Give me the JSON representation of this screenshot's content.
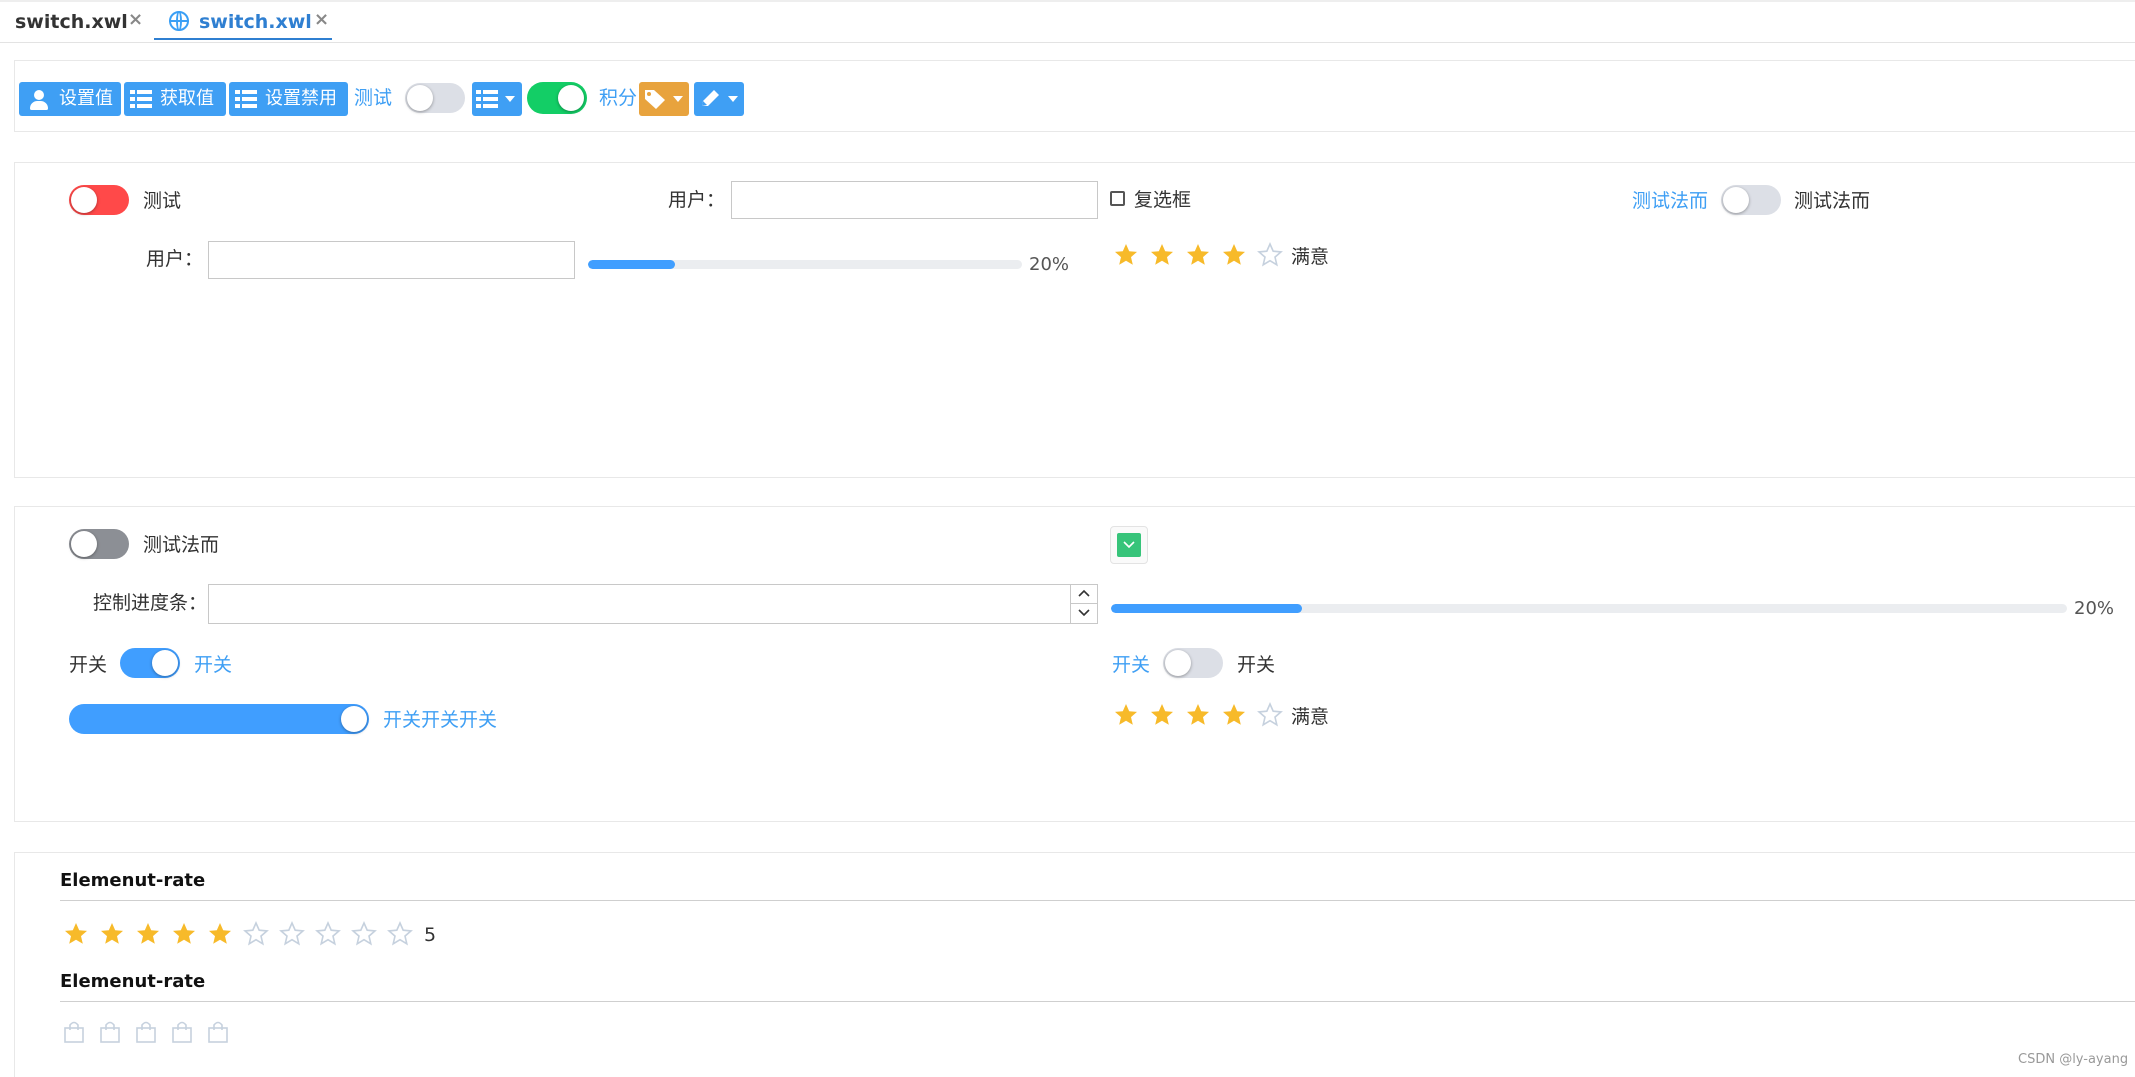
{
  "tabs": [
    {
      "label": "switch.xwl",
      "active": false
    },
    {
      "label": "switch.xwl",
      "active": true
    }
  ],
  "toolbar": {
    "set_value": "设置值",
    "get_value": "获取值",
    "set_disabled": "设置禁用",
    "test_label": "测试",
    "points_label": "积分"
  },
  "panel1": {
    "switch_label": "测试",
    "user_label_1": "用户：",
    "user_value_1": "",
    "checkbox_label": "复选框",
    "right_link": "测试法而",
    "right_switch_label": "测试法而",
    "user_label_2": "用户：",
    "user_value_2": "",
    "progress": 20,
    "progress_text": "20%",
    "rating": 4,
    "rating_max": 5,
    "rating_text": "满意"
  },
  "panel2": {
    "switch_label": "测试法而",
    "progress_label": "控制进度条：",
    "progress_input_value": "",
    "progress": 20,
    "progress_text": "20%",
    "switch2_left": "开关",
    "switch2_right": "开关",
    "switch3_left": "开关",
    "switch3_right": "开关",
    "wide_switch_text": "开关开关开关",
    "rating": 4,
    "rating_max": 5,
    "rating_text": "满意"
  },
  "panel3": {
    "title1": "Elemenut-rate",
    "rating": 5,
    "rating_max": 10,
    "rating_text": "5",
    "title2": "Elemenut-rate",
    "bag_count": 5
  },
  "footer": {
    "watermark": "CSDN @ly-ayang"
  },
  "colors": {
    "primary": "#409eff",
    "orange": "#e8a33d",
    "red": "#ff4949",
    "green": "#13ce66",
    "gray_switch": "#8c8f95",
    "inactive_switch": "#dcdfe6",
    "star_on": "#f7ba2a",
    "star_off": "#c6d1de"
  }
}
